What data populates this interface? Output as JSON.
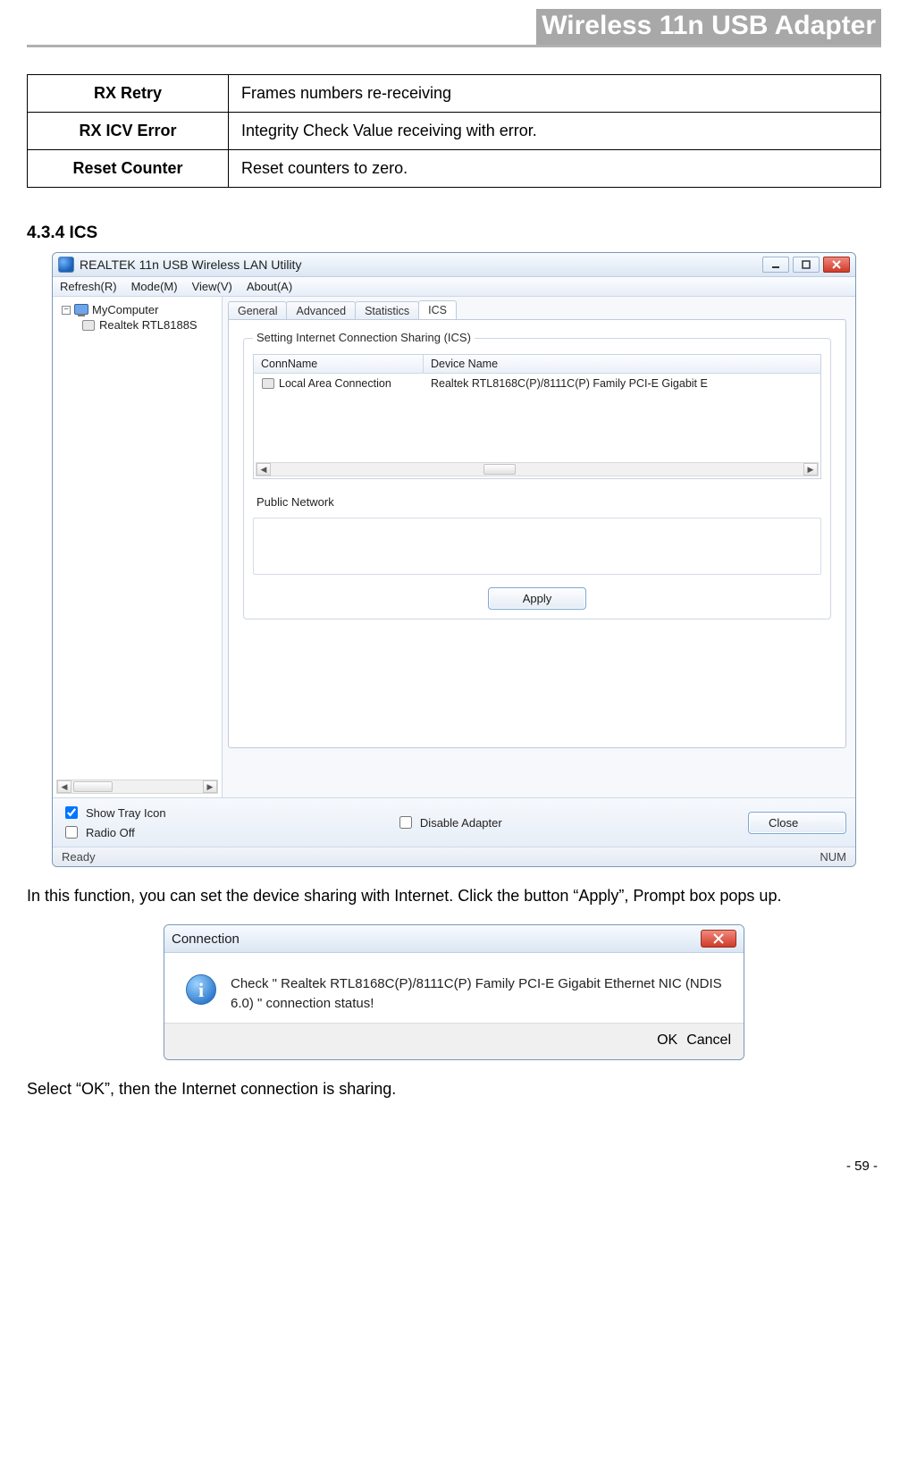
{
  "doc": {
    "header_title": "Wireless 11n USB Adapter",
    "page_number": "- 59 -"
  },
  "defs_table": [
    {
      "label": "RX Retry",
      "desc": "Frames numbers re-receiving"
    },
    {
      "label": "RX ICV Error",
      "desc": "Integrity Check Value receiving with error."
    },
    {
      "label": "Reset Counter",
      "desc": "Reset counters to zero."
    }
  ],
  "section_heading": "4.3.4    ICS",
  "utility": {
    "title": "REALTEK 11n USB Wireless LAN Utility",
    "menubar": {
      "refresh": "Refresh(R)",
      "mode": "Mode(M)",
      "view": "View(V)",
      "about": "About(A)"
    },
    "tree": {
      "root": "MyComputer",
      "child": "Realtek RTL8188S"
    },
    "tabs": {
      "general": "General",
      "advanced": "Advanced",
      "statistics": "Statistics",
      "ics": "ICS"
    },
    "group_legend": "Setting Internet Connection Sharing (ICS)",
    "list": {
      "headers": {
        "conn": "ConnName",
        "device": "Device Name"
      },
      "rows": [
        {
          "conn": "Local Area Connection",
          "device": "Realtek RTL8168C(P)/8111C(P) Family PCI-E Gigabit E"
        }
      ]
    },
    "public_network_label": "Public Network",
    "apply_label": "Apply",
    "bottom": {
      "show_tray": "Show Tray Icon",
      "radio_off": "Radio Off",
      "disable_adapter": "Disable Adapter",
      "close": "Close"
    },
    "status": {
      "left": "Ready",
      "right": "NUM"
    }
  },
  "paragraph1": "In this function, you can set the device sharing with Internet. Click the button “Apply”, Prompt box pops up.",
  "dialog": {
    "title": "Connection",
    "message": "Check \" Realtek RTL8168C(P)/8111C(P) Family PCI-E Gigabit Ethernet NIC (NDIS 6.0) \" connection status!",
    "ok": "OK",
    "cancel": "Cancel"
  },
  "paragraph2": "Select “OK”, then the Internet connection is sharing."
}
